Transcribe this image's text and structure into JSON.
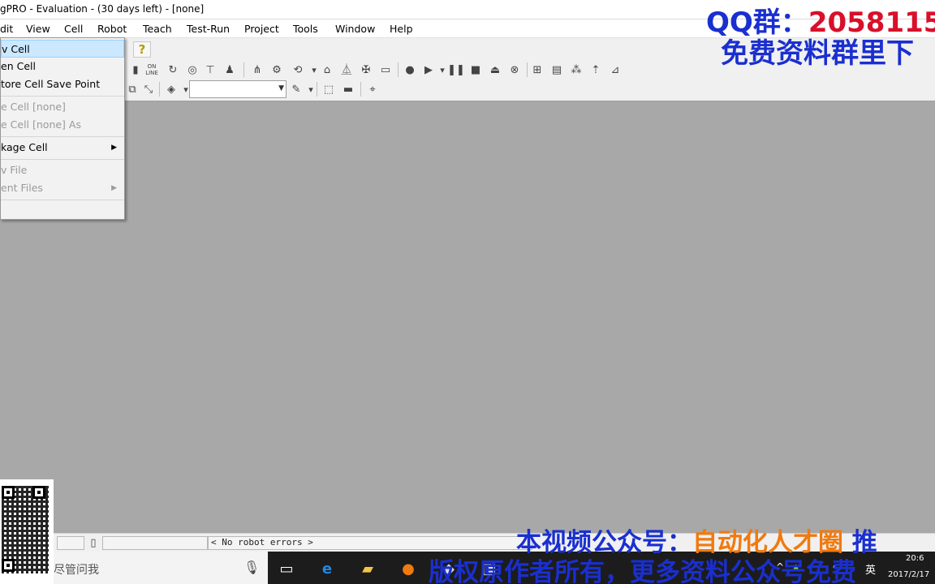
{
  "window": {
    "title": "gPRO - Evaluation - (30 days left) - [none]"
  },
  "menubar": {
    "items": [
      "dit",
      "View",
      "Cell",
      "Robot",
      "Teach",
      "Test-Run",
      "Project",
      "Tools",
      "Window",
      "Help"
    ]
  },
  "dropdown": {
    "items": [
      {
        "label": "v Cell",
        "state": "highlighted"
      },
      {
        "label": "en Cell",
        "state": "enabled"
      },
      {
        "label": "tore Cell Save Point",
        "state": "enabled"
      },
      {
        "label": "e Cell [none]",
        "state": "disabled"
      },
      {
        "label": "e Cell [none] As",
        "state": "disabled"
      },
      {
        "label": "kage Cell",
        "state": "enabled",
        "submenu": true
      },
      {
        "label": "v File",
        "state": "disabled"
      },
      {
        "label": "ent Files",
        "state": "disabled",
        "submenu": true
      }
    ]
  },
  "toolbar": {
    "online_label": "ON LINE",
    "help_icon": "help-icon",
    "combo_value": ""
  },
  "statusbar": {
    "errors_text": "< No robot errors >"
  },
  "taskbar": {
    "search_placeholder": "尽管问我",
    "ime_label": "英",
    "time": "20:6",
    "date": "2017/2/17"
  },
  "watermarks": {
    "qq_label": "QQ群：",
    "qq_number": "2058115",
    "line2": "免费资料群里下",
    "line3_prefix": "本视频公众号：",
    "line3_brand": "自动化人才圈",
    "line3_suffix": "推",
    "line4": "版权原作者所有，更多资料公众号免费"
  },
  "colors": {
    "workspace": "#a8a8a8",
    "watermark_blue": "#1a2fd0",
    "watermark_red": "#d8102a",
    "watermark_orange": "#f07a10",
    "menu_highlight": "#cce8ff"
  }
}
